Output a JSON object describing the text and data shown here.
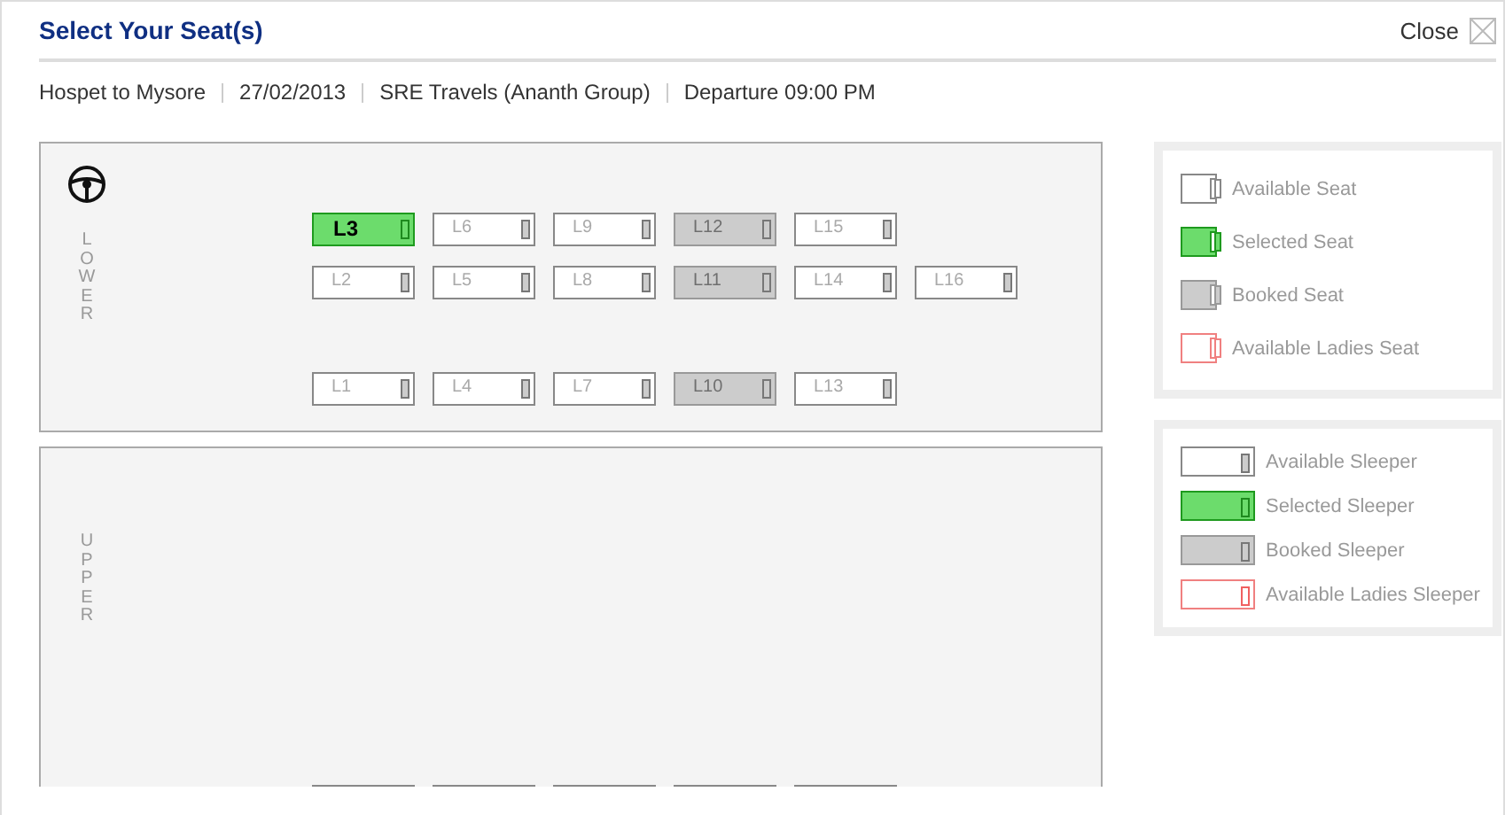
{
  "header": {
    "title": "Select Your Seat(s)",
    "close_label": "Close"
  },
  "trip": {
    "route": "Hospet to Mysore",
    "date": "27/02/2013",
    "operator": "SRE Travels (Ananth Group)",
    "departure": "Departure 09:00 PM"
  },
  "decks": [
    {
      "label": "LOWER",
      "rows": [
        [
          {
            "label": "L3",
            "selected": true,
            "booked": false
          },
          {
            "label": "L6",
            "selected": false,
            "booked": false
          },
          {
            "label": "L9",
            "selected": false,
            "booked": false
          },
          {
            "label": "L12",
            "selected": false,
            "booked": true
          },
          {
            "label": "L15",
            "selected": false,
            "booked": false
          }
        ],
        [
          {
            "label": "L2",
            "selected": false,
            "booked": false
          },
          {
            "label": "L5",
            "selected": false,
            "booked": false
          },
          {
            "label": "L8",
            "selected": false,
            "booked": false
          },
          {
            "label": "L11",
            "selected": false,
            "booked": true
          },
          {
            "label": "L14",
            "selected": false,
            "booked": false
          },
          {
            "label": "L16",
            "selected": false,
            "booked": false
          }
        ],
        [
          {
            "label": "L1",
            "selected": false,
            "booked": false
          },
          {
            "label": "L4",
            "selected": false,
            "booked": false
          },
          {
            "label": "L7",
            "selected": false,
            "booked": false
          },
          {
            "label": "L10",
            "selected": false,
            "booked": true
          },
          {
            "label": "L13",
            "selected": false,
            "booked": false
          }
        ]
      ]
    },
    {
      "label": "UPPER"
    }
  ],
  "legends": [
    {
      "kind": "seat",
      "items": [
        {
          "label": "Available Seat",
          "kind": "available"
        },
        {
          "label": "Selected Seat",
          "kind": "selected"
        },
        {
          "label": "Booked Seat",
          "kind": "booked"
        },
        {
          "label": "Available Ladies Seat",
          "kind": "ladies"
        }
      ]
    },
    {
      "kind": "sleeper",
      "items": [
        {
          "label": "Available Sleeper",
          "kind": "available"
        },
        {
          "label": "Selected Sleeper",
          "kind": "selected"
        },
        {
          "label": "Booked Sleeper",
          "kind": "booked"
        },
        {
          "label": "Available Ladies Sleeper",
          "kind": "ladies"
        }
      ]
    }
  ]
}
